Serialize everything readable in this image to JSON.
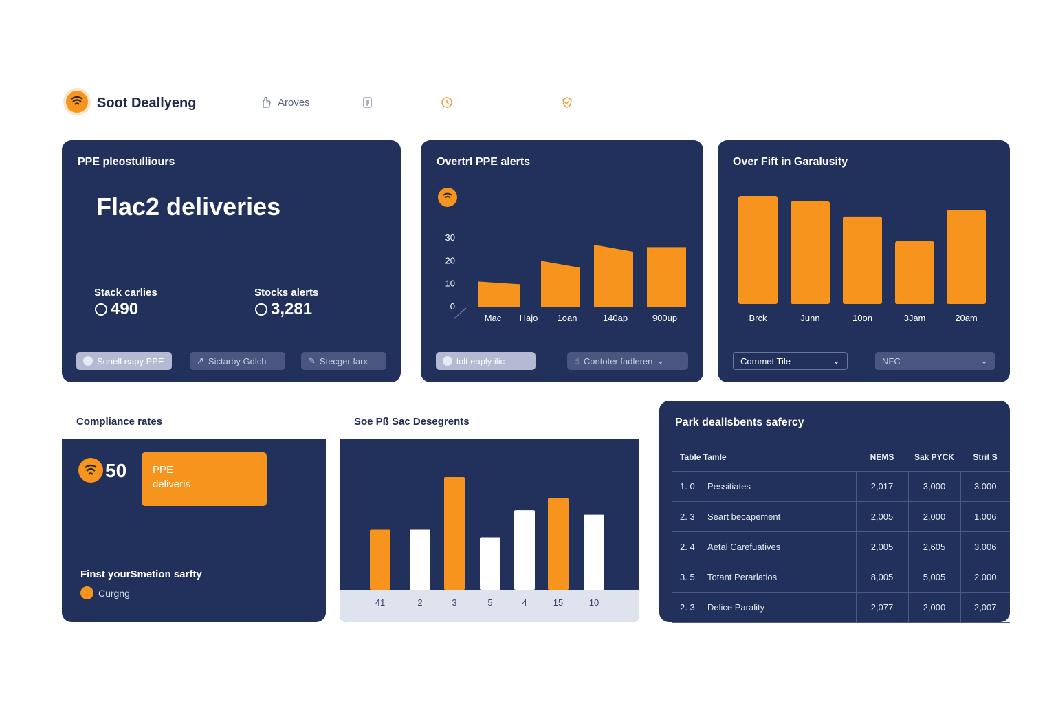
{
  "header": {
    "brand": "Soot Deallyeng",
    "nav": [
      {
        "label": "Aroves",
        "icon": "hand-icon"
      },
      {
        "label": "",
        "icon": "document-icon"
      },
      {
        "label": "",
        "icon": "clock-icon"
      },
      {
        "label": "",
        "icon": "shield-icon"
      }
    ]
  },
  "card_deliveries": {
    "title": "PPE pleostulliours",
    "headline": "Flac2 deliveries",
    "stats": [
      {
        "label": "Stack carlies",
        "value": "490"
      },
      {
        "label": "Stocks alerts",
        "value": "3,281"
      }
    ],
    "buttons": [
      "Sonell eapy PPE",
      "Sictarby Gdlch",
      "Stecger farx"
    ]
  },
  "card_alerts": {
    "title": "Overtrl PPE alerts",
    "filter_button": "lolt eaply ilic",
    "select_label": "Contoter fadleren",
    "colors": {
      "bar": "#f7941d"
    }
  },
  "card_garalusity": {
    "title": "Over Fift in Garalusity",
    "select_1": "Commet Tile",
    "select_2": "NFC"
  },
  "compliance": {
    "section_label": "Compliance rates",
    "score": "50",
    "badge_line1": "PPE",
    "badge_line2": "deliveris",
    "footer_title": "Finst yourSmetion sarfty",
    "footer_status": "Curgng"
  },
  "segments": {
    "section_label": "Soe Pß Sac Desegrents"
  },
  "table_card": {
    "title": "Park deallsbents safercy",
    "columns": [
      "Table  Tamle",
      "NEMS",
      "Sak PYCK",
      "Strit S"
    ],
    "rows": [
      {
        "id": "1. 0",
        "name": "Pessitiates",
        "a": "2,017",
        "b": "3,000",
        "c": "3.000"
      },
      {
        "id": "2. 3",
        "name": "Seart becapement",
        "a": "2,005",
        "b": "2,000",
        "c": "1.006"
      },
      {
        "id": "2. 4",
        "name": "Aetal Carefuatives",
        "a": "2,005",
        "b": "2,605",
        "c": "3.006"
      },
      {
        "id": "3. 5",
        "name": "Totant Perarlatios",
        "a": "8,005",
        "b": "5,005",
        "c": "2.000"
      },
      {
        "id": "2. 3",
        "name": "Delice Parality",
        "a": "2,077",
        "b": "2,000",
        "c": "2,007"
      }
    ]
  },
  "chart_data": [
    {
      "type": "bar",
      "title": "Overtrl PPE alerts",
      "categories": [
        "Mac",
        "Hajo",
        "1oan",
        "140ap",
        "900up"
      ],
      "values": [
        11,
        20,
        27,
        26
      ],
      "yticks": [
        "30",
        "20",
        "10",
        "0"
      ],
      "ylim": [
        0,
        30
      ],
      "colors": [
        "#f7941d"
      ]
    },
    {
      "type": "bar",
      "title": "Over Fift in Garalusity",
      "categories": [
        "Brck",
        "Junn",
        "10on",
        "3Jam",
        "20am"
      ],
      "values": [
        100,
        95,
        81,
        58,
        87
      ],
      "colors": [
        "#f7941d"
      ]
    },
    {
      "type": "bar",
      "title": "Soe Pß Sac Desegrents",
      "categories": [
        "41",
        "2",
        "3",
        "5",
        "4",
        "15",
        "10"
      ],
      "values": [
        40,
        40,
        75,
        35,
        53,
        61,
        50
      ],
      "bar_colors": [
        "#f7941d",
        "#ffffff",
        "#f7941d",
        "#ffffff",
        "#ffffff",
        "#f7941d",
        "#ffffff"
      ]
    }
  ]
}
